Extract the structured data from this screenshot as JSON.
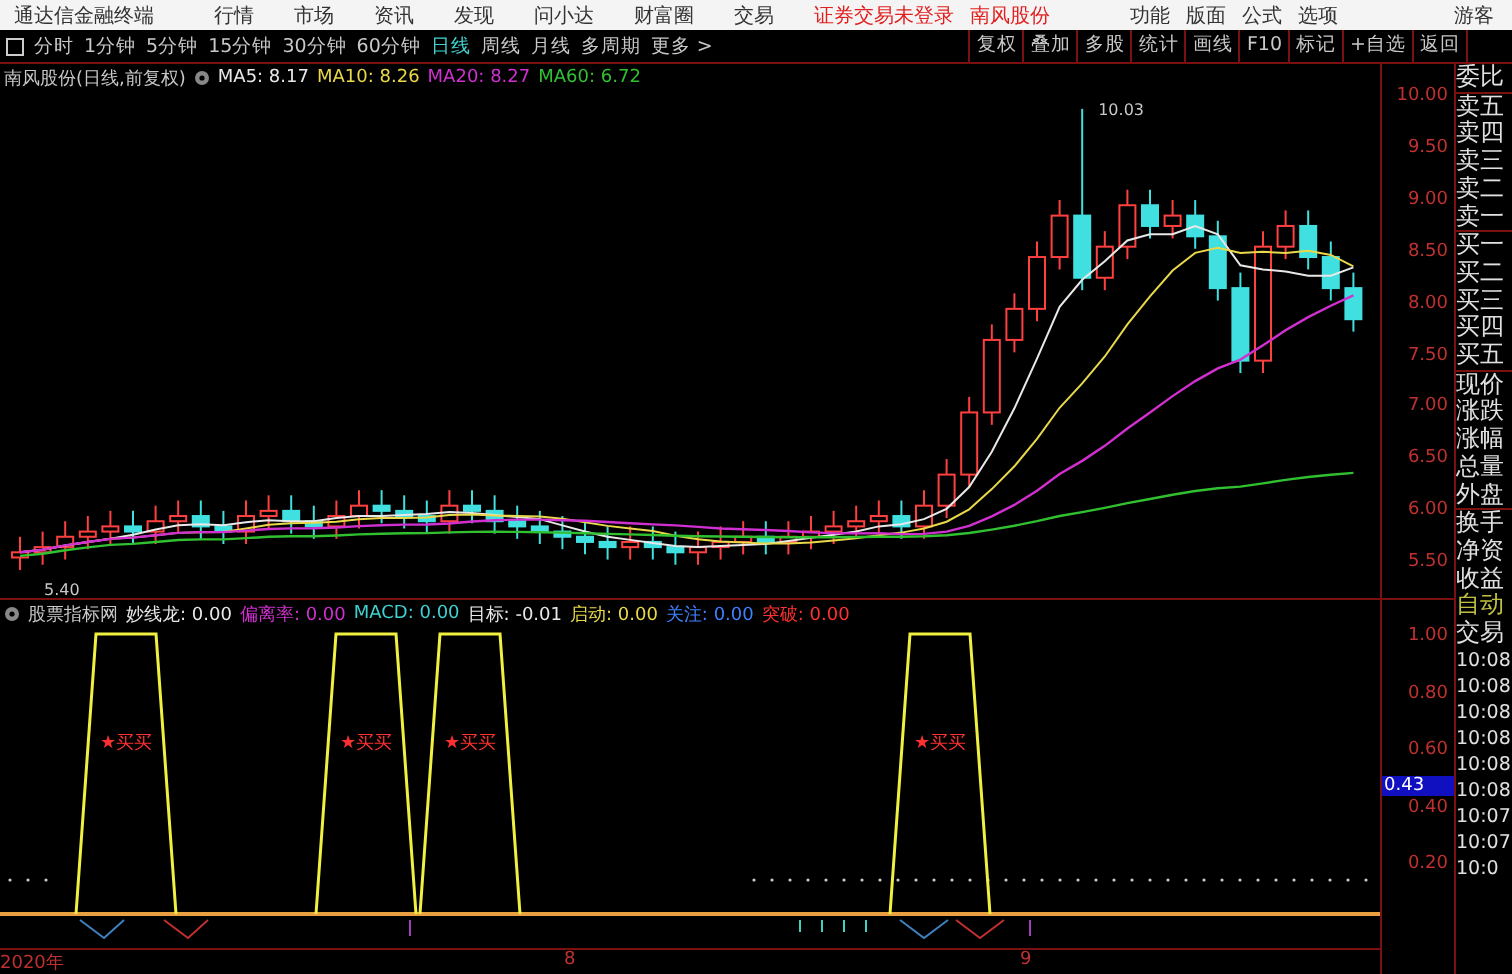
{
  "menu_bar": {
    "app_title": "通达信金融终端",
    "items": [
      "行情",
      "市场",
      "资讯",
      "发现",
      "问小达",
      "财富圈",
      "交易"
    ],
    "login_status": "证券交易未登录",
    "stock_name": "南风股份",
    "tools": [
      "功能",
      "版面",
      "公式",
      "选项"
    ],
    "user": "游客"
  },
  "period_tabs": [
    {
      "label": "分时",
      "selected": false
    },
    {
      "label": "1分钟",
      "selected": false
    },
    {
      "label": "5分钟",
      "selected": false
    },
    {
      "label": "15分钟",
      "selected": false
    },
    {
      "label": "30分钟",
      "selected": false
    },
    {
      "label": "60分钟",
      "selected": false
    },
    {
      "label": "日线",
      "selected": true
    },
    {
      "label": "周线",
      "selected": false
    },
    {
      "label": "月线",
      "selected": false
    },
    {
      "label": "多周期",
      "selected": false
    },
    {
      "label": "更多 >",
      "selected": false
    }
  ],
  "chart_tools": [
    "复权",
    "叠加",
    "多股",
    "统计",
    "画线",
    "F10",
    "标记",
    "+自选",
    "返回"
  ],
  "price_chart": {
    "title": "南风股份(日线,前复权)",
    "legend": [
      {
        "label": "MA5: 8.17",
        "color": "#e8e8e8"
      },
      {
        "label": "MA10: 8.26",
        "color": "#e8d84a"
      },
      {
        "label": "MA20: 8.27",
        "color": "#d030d0"
      },
      {
        "label": "MA60: 6.72",
        "color": "#30c030"
      }
    ],
    "high_label": "10.03",
    "low_label": "5.40",
    "axis": [
      "10.00",
      "9.50",
      "9.00",
      "8.50",
      "8.00",
      "7.50",
      "7.00",
      "6.50",
      "6.00",
      "5.50"
    ]
  },
  "indicator": {
    "title": "股票指标网",
    "legend": [
      {
        "label": "妙线龙: 0.00",
        "color": "#e8e8e8"
      },
      {
        "label": "偏离率: 0.00",
        "color": "#d030d0"
      },
      {
        "label": "MACD: 0.00",
        "color": "#40d0d0"
      },
      {
        "label": "目标: -0.01",
        "color": "#e8e8e8"
      },
      {
        "label": "启动: 0.00",
        "color": "#e8d84a"
      },
      {
        "label": "关注: 0.00",
        "color": "#4080ff"
      },
      {
        "label": "突破: 0.00",
        "color": "#ff3030"
      }
    ],
    "signals": [
      "★买买",
      "★买买",
      "★买买",
      "★买买"
    ],
    "axis": [
      "1.00",
      "0.80",
      "0.60",
      "0.40",
      "0.20"
    ],
    "cursor_value": "0.43"
  },
  "time_axis": [
    "2020年",
    "8",
    "9"
  ],
  "quote_panel": {
    "labels": [
      "委比",
      "卖五",
      "卖四",
      "卖三",
      "卖二",
      "卖一",
      "买一",
      "买二",
      "买三",
      "买四",
      "买五",
      "现价",
      "涨跌",
      "涨幅",
      "总量",
      "外盘",
      "换手",
      "净资",
      "收益"
    ],
    "auto_trade": "自动",
    "trade": "交易",
    "times": [
      "10:08",
      "10:08",
      "10:08",
      "10:08",
      "10:08",
      "10:08",
      "10:07",
      "10:07",
      "10:0"
    ]
  }
}
